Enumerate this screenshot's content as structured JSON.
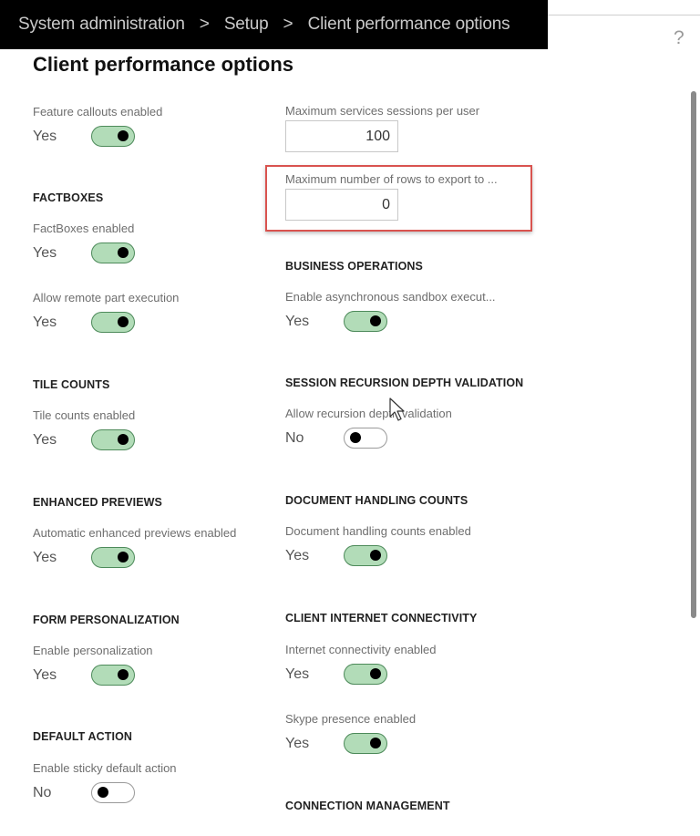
{
  "breadcrumb": {
    "items": [
      "System administration",
      "Setup",
      "Client performance options"
    ],
    "separator": ">"
  },
  "help_icon": "?",
  "page_title": "Client performance options",
  "left_column": [
    {
      "type": "toggle",
      "label": "Feature callouts enabled",
      "value": "Yes",
      "on": true
    },
    {
      "type": "group",
      "title": "FACTBOXES"
    },
    {
      "type": "toggle",
      "label": "FactBoxes enabled",
      "value": "Yes",
      "on": true
    },
    {
      "type": "toggle",
      "label": "Allow remote part execution",
      "value": "Yes",
      "on": true
    },
    {
      "type": "group",
      "title": "TILE COUNTS"
    },
    {
      "type": "toggle",
      "label": "Tile counts enabled",
      "value": "Yes",
      "on": true
    },
    {
      "type": "group",
      "title": "ENHANCED PREVIEWS"
    },
    {
      "type": "toggle",
      "label": "Automatic enhanced previews enabled",
      "value": "Yes",
      "on": true
    },
    {
      "type": "group",
      "title": "FORM PERSONALIZATION"
    },
    {
      "type": "toggle",
      "label": "Enable personalization",
      "value": "Yes",
      "on": true
    },
    {
      "type": "group",
      "title": "DEFAULT ACTION"
    },
    {
      "type": "toggle",
      "label": "Enable sticky default action",
      "value": "No",
      "on": false
    }
  ],
  "right_column": [
    {
      "type": "number",
      "label": "Maximum services sessions per user",
      "value": "100"
    },
    {
      "type": "number",
      "label": "Maximum number of rows to export to ...",
      "value": "0",
      "highlighted": true
    },
    {
      "type": "group",
      "title": "BUSINESS OPERATIONS"
    },
    {
      "type": "toggle",
      "label": "Enable asynchronous sandbox execut...",
      "value": "Yes",
      "on": true
    },
    {
      "type": "group",
      "title": "SESSION RECURSION DEPTH VALIDATION"
    },
    {
      "type": "toggle",
      "label": "Allow recursion depth validation",
      "value": "No",
      "on": false
    },
    {
      "type": "group",
      "title": "DOCUMENT HANDLING COUNTS"
    },
    {
      "type": "toggle",
      "label": "Document handling counts enabled",
      "value": "Yes",
      "on": true
    },
    {
      "type": "group",
      "title": "CLIENT INTERNET CONNECTIVITY"
    },
    {
      "type": "toggle",
      "label": "Internet connectivity enabled",
      "value": "Yes",
      "on": true
    },
    {
      "type": "toggle",
      "label": "Skype presence enabled",
      "value": "Yes",
      "on": true
    },
    {
      "type": "group",
      "title": "CONNECTION MANAGEMENT"
    }
  ],
  "colors": {
    "toggle_on_fill": "#b2dcb8",
    "toggle_on_border": "#4d8a5a",
    "highlight_border": "#d9534f",
    "topbar_bg": "#000000"
  }
}
